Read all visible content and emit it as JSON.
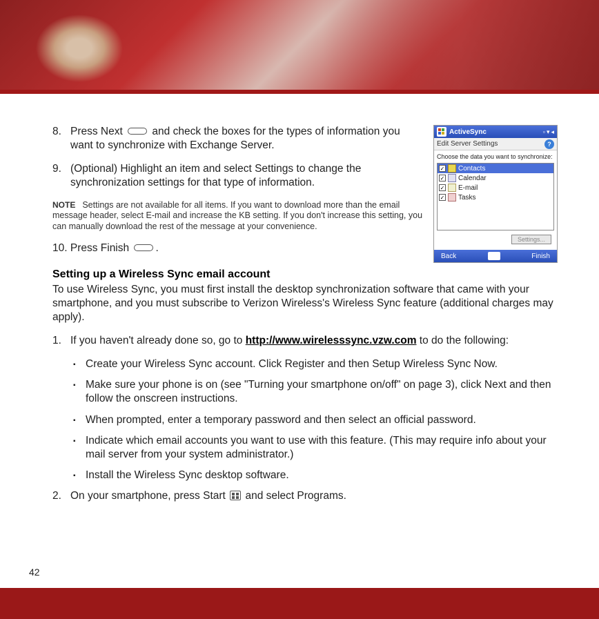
{
  "header": {},
  "steps": {
    "s8": {
      "num": "8.",
      "text_before": "Press Next ",
      "text_after": " and check the boxes for the types of information you want to synchronize with Exchange Server."
    },
    "s9": {
      "num": "9.",
      "text": "(Optional) Highlight an item and select Settings to change the synchronization settings for that type of information."
    },
    "s10_label": "10. Press Finish ",
    "s10_after": "."
  },
  "note": {
    "label": "NOTE",
    "text": "Settings are not available for all items. If you want to download more than the email message header, select E-mail and increase the KB setting. If you don't increase this setting, you can manually download the rest of the message at your convenience."
  },
  "section": {
    "heading": "Setting up a Wireless Sync email account",
    "para": "To use Wireless Sync, you must first install the desktop synchronization software that came with your smartphone, and you must subscribe to Verizon Wireless's Wireless Sync feature (additional charges may apply)."
  },
  "steps2": {
    "s1": {
      "num": "1.",
      "before": "If you haven't already done so, go to ",
      "link": "http://www.wirelesssync.vzw.com",
      "after": " to do the following:"
    },
    "s2": {
      "num": "2.",
      "before": "On your smartphone, press Start ",
      "after": " and select Programs."
    }
  },
  "bullets": [
    "Create your Wireless Sync account. Click Register and then Setup Wireless Sync Now.",
    "Make sure your phone is on (see \"Turning your smartphone on/off\" on page 3), click Next and then follow the onscreen instructions.",
    "When prompted, enter a temporary password and then select an official password.",
    "Indicate which email accounts you want to use with this feature. (This may require info about your mail server from your system administrator.)",
    "Install the Wireless Sync desktop software."
  ],
  "screenshot": {
    "title": "ActiveSync",
    "subtitle": "Edit Server Settings",
    "help": "?",
    "instruction": "Choose the data you want to synchronize:",
    "items": [
      {
        "checked": true,
        "label": "Contacts",
        "selected": true
      },
      {
        "checked": true,
        "label": "Calendar",
        "selected": false
      },
      {
        "checked": true,
        "label": "E-mail",
        "selected": false
      },
      {
        "checked": true,
        "label": "Tasks",
        "selected": false
      }
    ],
    "settings_btn": "Settings...",
    "back": "Back",
    "finish": "Finish"
  },
  "page_number": "42"
}
